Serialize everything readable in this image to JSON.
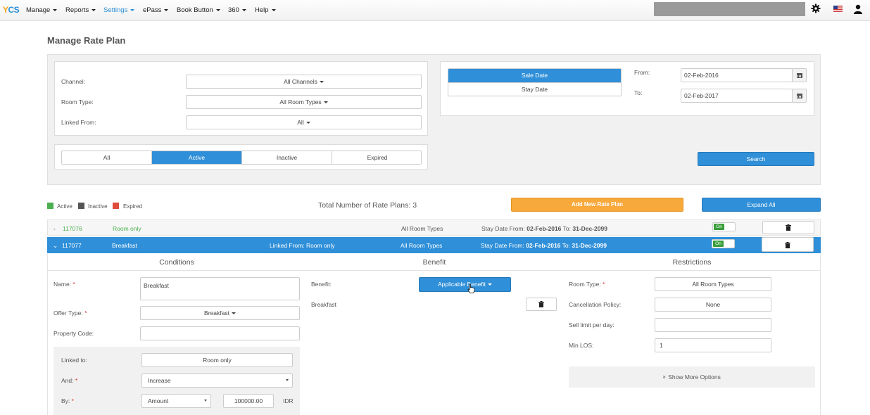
{
  "nav": {
    "logo": "YCS",
    "items": [
      {
        "label": "Manage",
        "active": false
      },
      {
        "label": "Reports",
        "active": false
      },
      {
        "label": "Settings",
        "active": true
      },
      {
        "label": "ePass",
        "active": false
      },
      {
        "label": "Book Button",
        "active": false
      },
      {
        "label": "360",
        "active": false
      },
      {
        "label": "Help",
        "active": false
      }
    ],
    "icons": [
      "gear-icon",
      "us-flag-icon",
      "user-icon"
    ]
  },
  "page_title": "Manage Rate Plan",
  "filters": {
    "channel_label": "Channel:",
    "channel_value": "All Channels",
    "room_type_label": "Room Type:",
    "room_type_value": "All Room Types",
    "linked_from_label": "Linked From:",
    "linked_from_value": "All",
    "status_tabs": [
      {
        "label": "All",
        "active": false
      },
      {
        "label": "Active",
        "active": true
      },
      {
        "label": "Inactive",
        "active": false
      },
      {
        "label": "Expired",
        "active": false
      }
    ],
    "date_types": [
      {
        "label": "Sale Date",
        "active": true
      },
      {
        "label": "Stay Date",
        "active": false
      }
    ],
    "from_label": "From:",
    "from_value": "02-Feb-2016",
    "to_label": "To:",
    "to_value": "02-Feb-2017",
    "search_label": "Search"
  },
  "legend": [
    {
      "label": "Active",
      "color": "#4caf50"
    },
    {
      "label": "Inactive",
      "color": "#555555"
    },
    {
      "label": "Expired",
      "color": "#e04b3c"
    }
  ],
  "total_label": "Total Number of Rate Plans: 3",
  "add_button": "Add New Rate Plan",
  "expand_button": "Expand All",
  "rate_plans": [
    {
      "id": "117076",
      "name": "Room only",
      "linked_from": "",
      "room_types": "All Room Types",
      "stay_prefix": "Stay Date From:",
      "stay_from": "02-Feb-2016",
      "stay_to_label": "To:",
      "stay_to": "31-Dec-2099",
      "toggle": "On",
      "expanded": false
    },
    {
      "id": "117077",
      "name": "Breakfast",
      "linked_from": "Linked From: Room only",
      "room_types": "All Room Types",
      "stay_prefix": "Stay Date From:",
      "stay_from": "02-Feb-2016",
      "stay_to_label": "To:",
      "stay_to": "31-Dec-2099",
      "toggle": "On",
      "expanded": true
    }
  ],
  "detail": {
    "conditions_head": "Conditions",
    "benefit_head": "Benefit",
    "restrictions_head": "Restrictions",
    "name_label": "Name:",
    "name_value": "Breakfast",
    "offer_type_label": "Offer Type:",
    "offer_type_value": "Breakfast",
    "property_code_label": "Property Code:",
    "property_code_value": "",
    "linked_to_label": "Linked to:",
    "linked_to_value": "Room only",
    "and_label": "And:",
    "and_value": "Increase",
    "by_label": "By:",
    "by_value": "Amount",
    "by_amount": "100000.00",
    "currency": "IDR",
    "benefit_label": "Benefit:",
    "benefit_button": "Applicable Benefit",
    "benefit_item": "Breakfast",
    "room_type_label": "Room Type:",
    "room_type_value": "All Room Types",
    "cancel_label": "Cancellation Policy:",
    "cancel_value": "None",
    "sell_limit_label": "Sell limit per day:",
    "sell_limit_value": "",
    "min_los_label": "Min LOS:",
    "min_los_value": "1",
    "show_more": "Show More Options"
  }
}
